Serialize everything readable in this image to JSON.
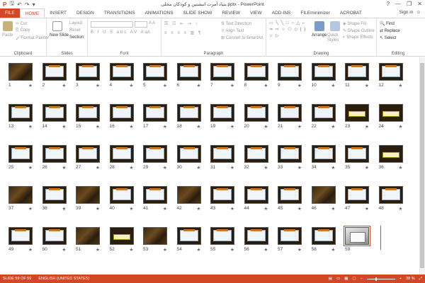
{
  "window": {
    "title": "بنیاد آمرت انبشتین و کودکان محلی.pptx - PowerPoint",
    "controls": [
      "?",
      "—",
      "❐",
      "✕"
    ]
  },
  "tabs": [
    "FILE",
    "HOME",
    "INSERT",
    "DESIGN",
    "TRANSITIONS",
    "ANIMATIONS",
    "SLIDE SHOW",
    "REVIEW",
    "VIEW",
    "ADD-INS",
    "FILEminimizer",
    "ACROBAT"
  ],
  "signin": "Sign in",
  "ribbon": {
    "clipboard": {
      "label": "Clipboard",
      "paste": "Paste",
      "cut": "Cut",
      "copy": "Copy",
      "format_painter": "Format Painter"
    },
    "slides": {
      "label": "Slides",
      "new_slide": "New Slide",
      "layout": "Layout",
      "reset": "Reset",
      "section": "Section"
    },
    "font": {
      "label": "Font"
    },
    "paragraph": {
      "label": "Paragraph",
      "text_direction": "Text Direction",
      "align_text": "Align Text",
      "convert_smartart": "Convert to SmartArt"
    },
    "drawing": {
      "label": "Drawing",
      "arrange": "Arrange",
      "quick_styles": "Quick Styles",
      "shape_fill": "Shape Fill",
      "shape_outline": "Shape Outline",
      "shape_effects": "Shape Effects"
    },
    "editing": {
      "label": "Editing",
      "find": "Find",
      "replace": "Replace",
      "select": "Select"
    }
  },
  "slides": [
    {
      "n": "1",
      "k": "dark"
    },
    {
      "n": "2",
      "k": "text"
    },
    {
      "n": "3",
      "k": "text"
    },
    {
      "n": "4",
      "k": "text"
    },
    {
      "n": "5",
      "k": "text"
    },
    {
      "n": "6",
      "k": "text"
    },
    {
      "n": "7",
      "k": "text"
    },
    {
      "n": "8",
      "k": "text"
    },
    {
      "n": "9",
      "k": "text"
    },
    {
      "n": "10",
      "k": "text"
    },
    {
      "n": "11",
      "k": "text"
    },
    {
      "n": "12",
      "k": "text"
    },
    {
      "n": "13",
      "k": "text"
    },
    {
      "n": "14",
      "k": "text"
    },
    {
      "n": "15",
      "k": "text"
    },
    {
      "n": "16",
      "k": "text"
    },
    {
      "n": "17",
      "k": "text"
    },
    {
      "n": "18",
      "k": "text"
    },
    {
      "n": "19",
      "k": "text"
    },
    {
      "n": "20",
      "k": "text"
    },
    {
      "n": "21",
      "k": "text"
    },
    {
      "n": "22",
      "k": "text"
    },
    {
      "n": "23",
      "k": "title"
    },
    {
      "n": "24",
      "k": "title"
    },
    {
      "n": "25",
      "k": "text"
    },
    {
      "n": "26",
      "k": "text"
    },
    {
      "n": "27",
      "k": "text"
    },
    {
      "n": "28",
      "k": "text"
    },
    {
      "n": "29",
      "k": "text"
    },
    {
      "n": "30",
      "k": "text"
    },
    {
      "n": "31",
      "k": "text"
    },
    {
      "n": "32",
      "k": "text"
    },
    {
      "n": "33",
      "k": "text"
    },
    {
      "n": "34",
      "k": "text"
    },
    {
      "n": "35",
      "k": "text"
    },
    {
      "n": "36",
      "k": "title"
    },
    {
      "n": "37",
      "k": "dark"
    },
    {
      "n": "38",
      "k": "text"
    },
    {
      "n": "39",
      "k": "dark"
    },
    {
      "n": "40",
      "k": "text"
    },
    {
      "n": "41",
      "k": "text"
    },
    {
      "n": "42",
      "k": "dark"
    },
    {
      "n": "43",
      "k": "text"
    },
    {
      "n": "44",
      "k": "text"
    },
    {
      "n": "45",
      "k": "text"
    },
    {
      "n": "46",
      "k": "dark"
    },
    {
      "n": "47",
      "k": "text"
    },
    {
      "n": "48",
      "k": "text"
    },
    {
      "n": "49",
      "k": "text"
    },
    {
      "n": "50",
      "k": "text"
    },
    {
      "n": "51",
      "k": "dark"
    },
    {
      "n": "52",
      "k": "title"
    },
    {
      "n": "53",
      "k": "dark"
    },
    {
      "n": "54",
      "k": "text"
    },
    {
      "n": "55",
      "k": "text"
    },
    {
      "n": "56",
      "k": "text"
    },
    {
      "n": "57",
      "k": "text"
    },
    {
      "n": "58",
      "k": "text"
    },
    {
      "n": "59",
      "k": "photo"
    }
  ],
  "star_glyph": "★",
  "selected_slide": "59",
  "status": {
    "slide_info": "SLIDE 59 OF 59",
    "language": "ENGLISH (UNITED STATES)",
    "zoom": "38 %"
  },
  "colors": {
    "accent": "#d24726"
  }
}
